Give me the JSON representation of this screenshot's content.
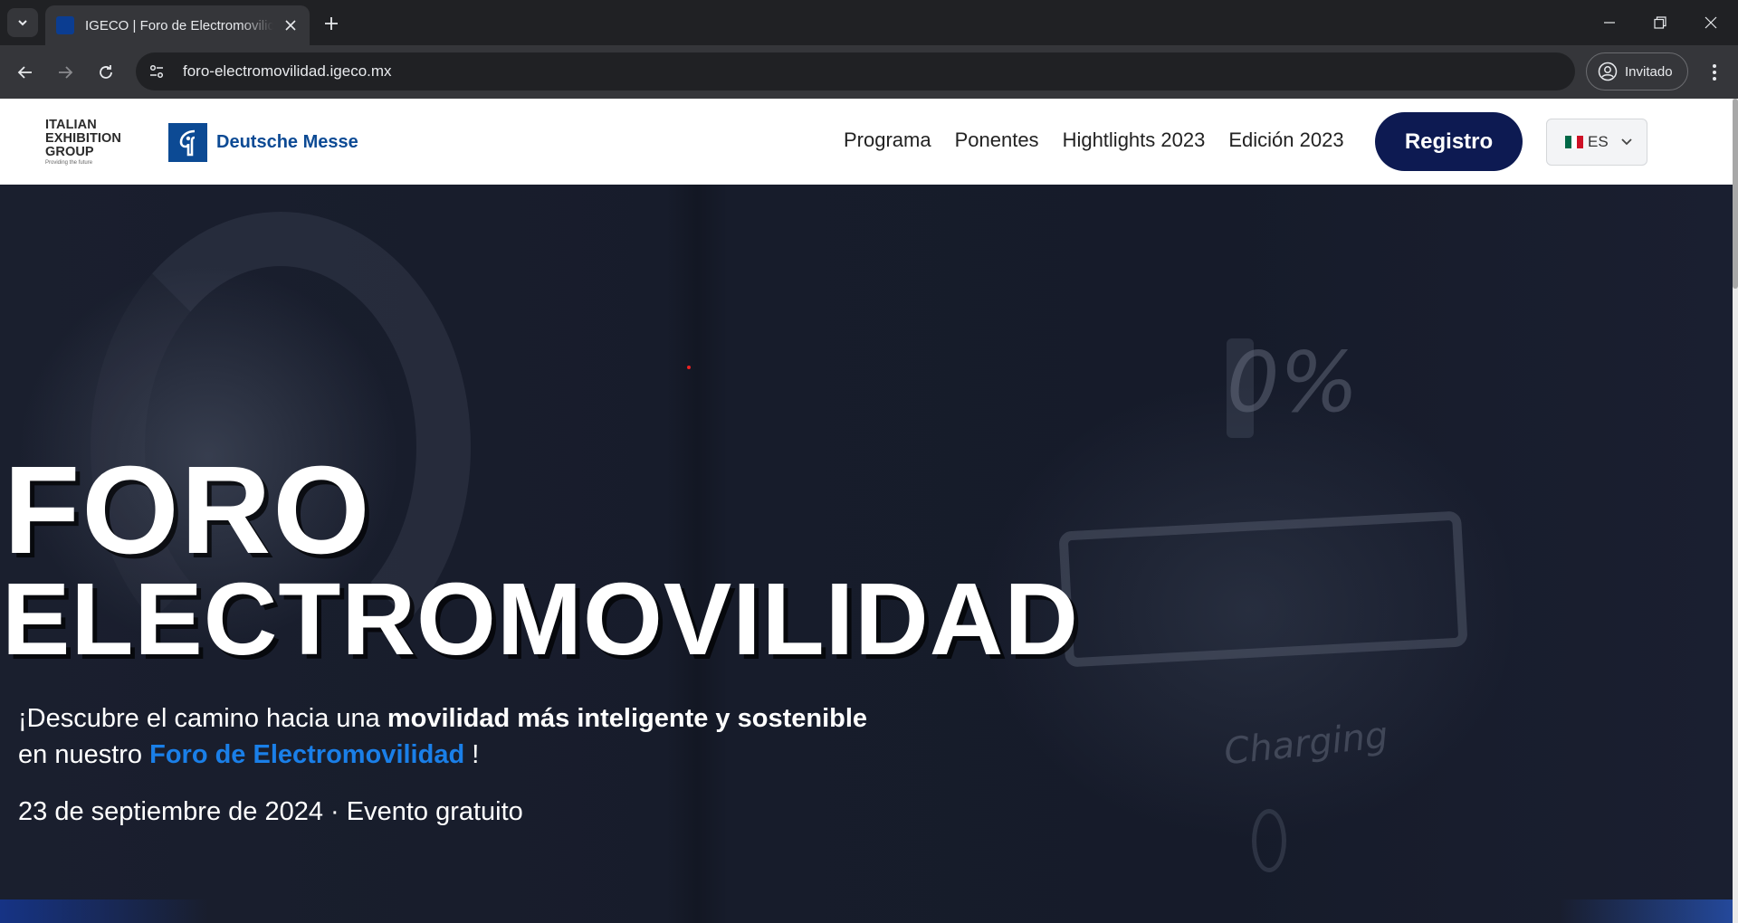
{
  "browser": {
    "tab_title": "IGECO | Foro de Electromovilidad",
    "url": "foro-electromovilidad.igeco.mx",
    "profile_label": "Invitado"
  },
  "header": {
    "ieg_logo_lines": [
      "ITALIAN",
      "EXHIBITION",
      "GROUP"
    ],
    "ieg_tagline": "Providing the future",
    "dm_logo_text": "Deutsche Messe",
    "nav": [
      "Programa",
      "Ponentes",
      "Hightlights 2023",
      "Edición 2023"
    ],
    "cta_label": "Registro",
    "language": "ES"
  },
  "hero": {
    "title_line1": "FORO",
    "title_line2": "ELECTROMOVILIDAD",
    "sub_part1": "¡Descubre el camino hacia una ",
    "sub_bold": "movilidad más inteligente y sostenible",
    "sub_part2": "en nuestro ",
    "sub_highlight": "Foro de Electromovilidad",
    "sub_end": " !",
    "date_line": "23 de septiembre de 2024 · Evento gratuito",
    "bg_percent": "0%",
    "bg_charging": "Charging"
  },
  "colors": {
    "cta_bg": "#0d1a52",
    "highlight": "#1a7fe8",
    "dm_blue": "#0c4a94"
  }
}
